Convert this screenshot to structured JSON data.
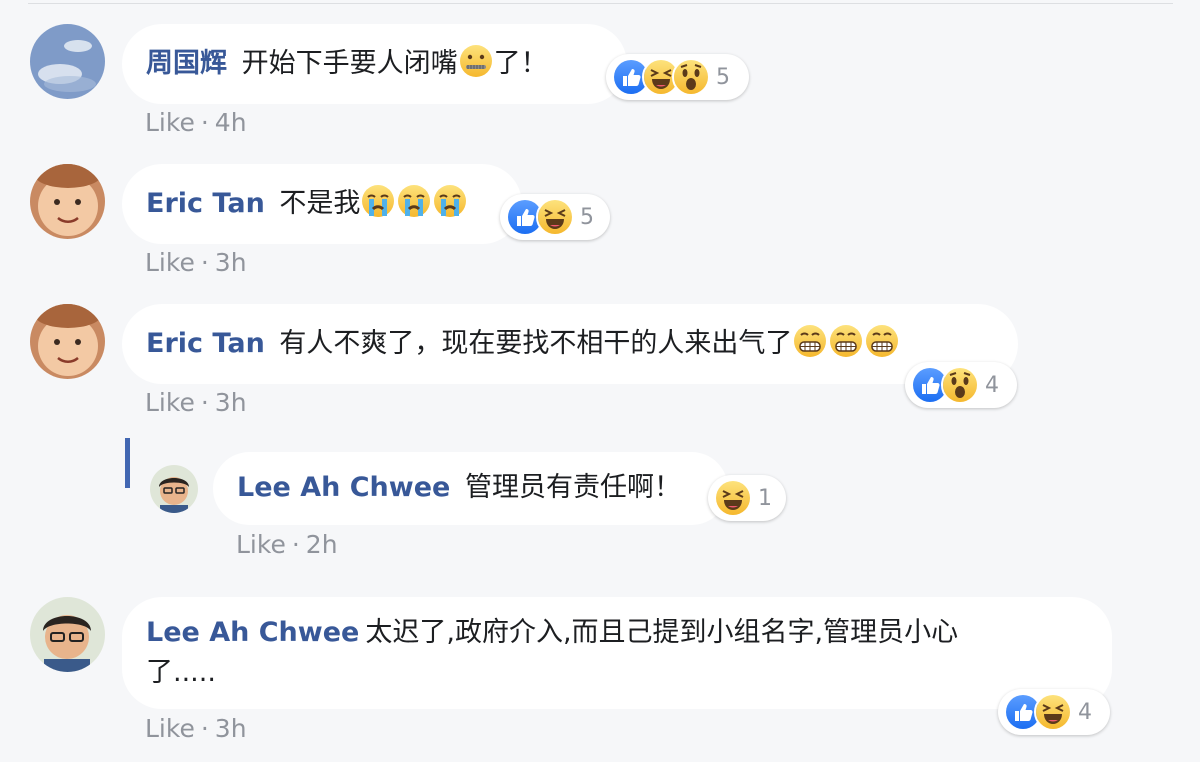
{
  "comments": [
    {
      "author": "周国辉",
      "text": "开始下手要人闭嘴",
      "text_after": "了！",
      "like_label": "Like",
      "time": "4h",
      "reaction_count": "5"
    },
    {
      "author": "Eric Tan",
      "text": "不是我",
      "like_label": "Like",
      "time": "3h",
      "reaction_count": "5"
    },
    {
      "author": "Eric Tan",
      "text": "有人不爽了，现在要找不相干的人来出气了",
      "like_label": "Like",
      "time": "3h",
      "reaction_count": "4"
    },
    {
      "author": "Lee Ah Chwee",
      "text": "管理员有责任啊！",
      "like_label": "Like",
      "time": "2h",
      "reaction_count": "1"
    },
    {
      "author": "Lee Ah Chwee",
      "text_line1": "太迟了,政府介入,而且己提到小组名字,管理员小心",
      "text_line2": "了.....",
      "like_label": "Like",
      "time": "3h",
      "reaction_count": "4"
    }
  ],
  "colors": {
    "name": "#385898",
    "meta": "#90949c",
    "background": "#f6f7f9",
    "bubble": "#ffffff",
    "like_blue": "#4267b2",
    "emoji_yellow": "#f7c542"
  },
  "icons": [
    "like-reaction-icon",
    "haha-reaction-icon",
    "wow-reaction-icon",
    "zipper-mouth-emoji",
    "crying-emoji",
    "grimacing-emoji"
  ]
}
